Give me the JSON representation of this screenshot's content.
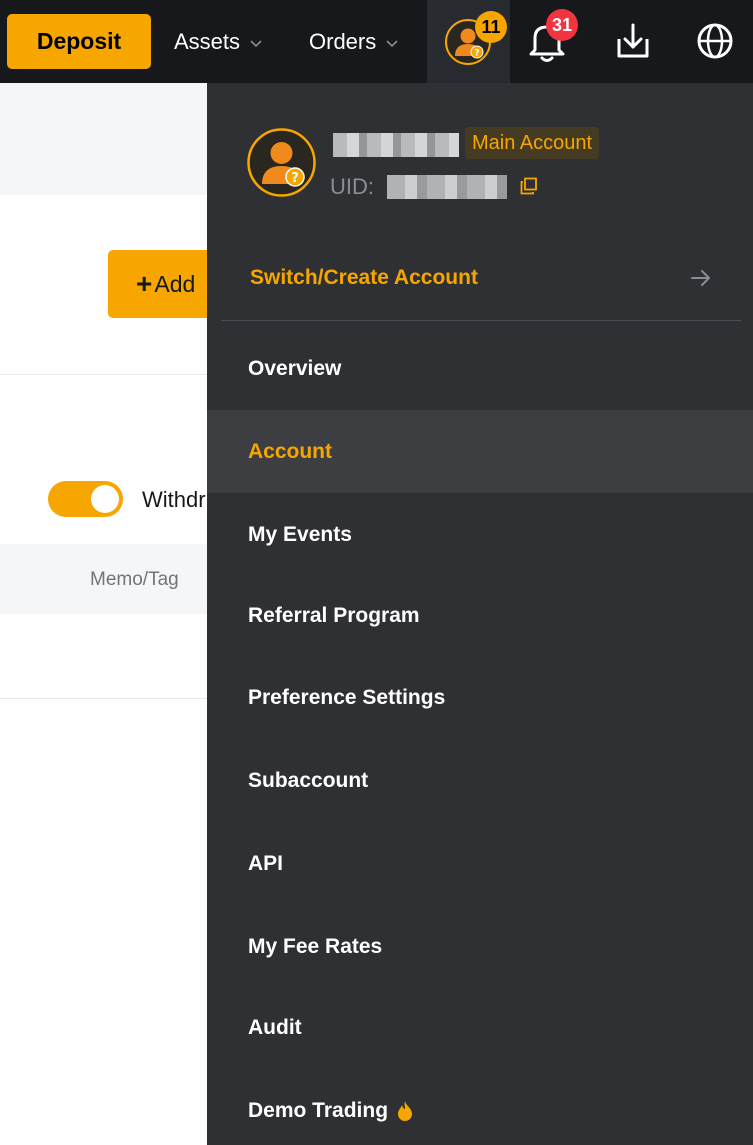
{
  "header": {
    "deposit_label": "Deposit",
    "assets_label": "Assets",
    "orders_label": "Orders",
    "avatar_badge": "11",
    "bell_badge": "31"
  },
  "background": {
    "add_label": "Add",
    "withdraw_label": "Withdr",
    "memo_label": "Memo/Tag"
  },
  "dropdown": {
    "account_badge": "Main Account",
    "uid_label": "UID:",
    "switch_label": "Switch/Create Account",
    "items": [
      {
        "label": "Overview"
      },
      {
        "label": "Account"
      },
      {
        "label": "My Events"
      },
      {
        "label": "Referral Program"
      },
      {
        "label": "Preference Settings"
      },
      {
        "label": "Subaccount"
      },
      {
        "label": "API"
      },
      {
        "label": "My Fee Rates"
      },
      {
        "label": "Audit"
      },
      {
        "label": "Demo Trading"
      }
    ]
  },
  "colors": {
    "accent": "#f7a600",
    "nav_bg": "#16181b",
    "panel_bg": "#2e3033",
    "active_bg": "#3c3e41",
    "bell_badge": "#f1343f"
  }
}
